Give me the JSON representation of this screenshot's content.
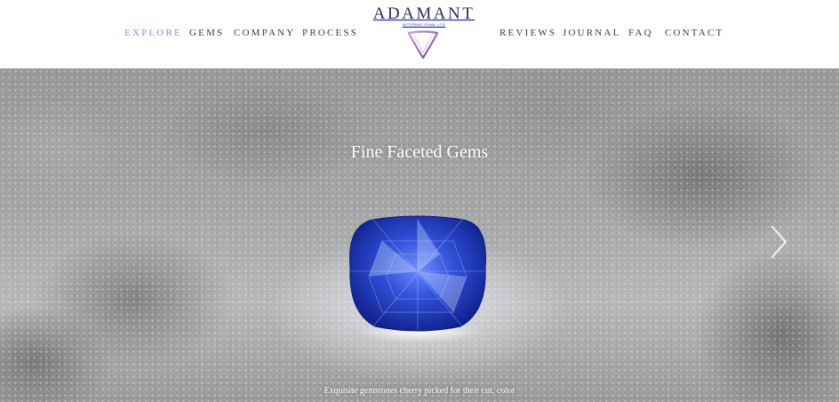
{
  "nav_left": [
    "EXPLORE",
    "GEMS",
    "COMPANY",
    "PROCESS"
  ],
  "nav_right": [
    "REVIEWS",
    "JOURNAL",
    "FAQ",
    "CONTACT"
  ],
  "logo": {
    "word": "ADAMANT",
    "sub": "INTERNATIONAL LTD"
  },
  "hero": {
    "title": "Fine Faceted Gems",
    "subtitle": "Exquisite gemstones cherry picked for their cut, color"
  },
  "colors": {
    "active_nav": "#b07fc4",
    "logo": "#2b2f5a",
    "gem": "#2f4fd6"
  },
  "icons": {
    "logo_mark": "triangle-gem-icon",
    "next": "chevron-right-icon"
  }
}
